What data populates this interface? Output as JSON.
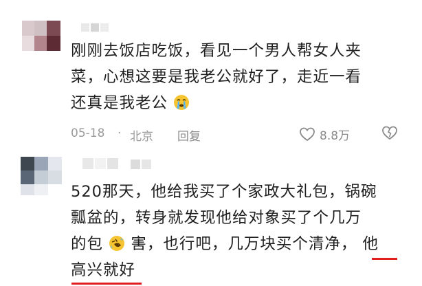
{
  "comments": [
    {
      "lines": [
        "刚刚去饭店吃饭，看见一个男人帮女人夹",
        "菜，心想这要是我老公就好了，走近一看",
        "还真是我老公"
      ],
      "emoji": "crying-face-icon",
      "date": "05-18",
      "separator": "·",
      "location": "北京",
      "reply_label": "回复",
      "likes": "8.8万"
    },
    {
      "lines": [
        "520那天，他给我买了个家政大礼包，锅碗",
        "瓢盆的，转身就发现他给对象买了个几万",
        "的包",
        "害，也行吧，几万块买个清净，",
        "他",
        "高兴就好"
      ],
      "emoji": "rolling-laughing-face-icon"
    }
  ],
  "colors": {
    "accent_underline": "#e02020",
    "meta_text": "#9a9a9a"
  }
}
